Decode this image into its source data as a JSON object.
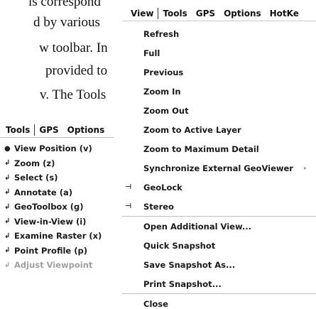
{
  "document": {
    "lines": [
      "is correspond",
      "d by various",
      "w toolbar. In",
      "provided to",
      "v. The Tools"
    ]
  },
  "tools_menu": {
    "menubar": [
      "Tools",
      "GPS",
      "Options"
    ],
    "items": [
      {
        "label": "View Position (v)",
        "mark": "●",
        "disabled": false
      },
      {
        "label": "Zoom (z)",
        "mark": "↲",
        "disabled": false
      },
      {
        "label": "Select (s)",
        "mark": "↲",
        "disabled": false
      },
      {
        "label": "Annotate (a)",
        "mark": "↲",
        "disabled": false
      },
      {
        "label": "GeoToolbox (g)",
        "mark": "↲",
        "disabled": false
      },
      {
        "label": "View-in-View (i)",
        "mark": "↲",
        "disabled": false
      },
      {
        "label": "Examine Raster (x)",
        "mark": "↲",
        "disabled": false
      },
      {
        "label": "Point Profile (p)",
        "mark": "↲",
        "disabled": false
      },
      {
        "label": "Adjust Viewpoint",
        "mark": "↲",
        "disabled": true
      }
    ]
  },
  "view_menu": {
    "menubar": [
      "View",
      "Tools",
      "GPS",
      "Options",
      "HotKe"
    ],
    "items": [
      {
        "label": "Refresh"
      },
      {
        "label": "Full"
      },
      {
        "label": "Previous"
      },
      {
        "label": "Zoom In"
      },
      {
        "label": "Zoom Out"
      },
      {
        "label": "Zoom to Active Layer"
      },
      {
        "label": "Zoom to Maximum Detail"
      },
      {
        "label": "Synchronize External GeoViewer",
        "arrow": "▸"
      },
      {
        "label": "GeoLock",
        "mark": "⊣"
      },
      {
        "label": "Stereo",
        "mark": "⊣"
      },
      {
        "label": "Open Additional View..."
      },
      {
        "label": "Quick Snapshot"
      },
      {
        "label": "Save Snapshot As..."
      },
      {
        "label": "Print Snapshot..."
      },
      {
        "label": "Close"
      }
    ]
  }
}
